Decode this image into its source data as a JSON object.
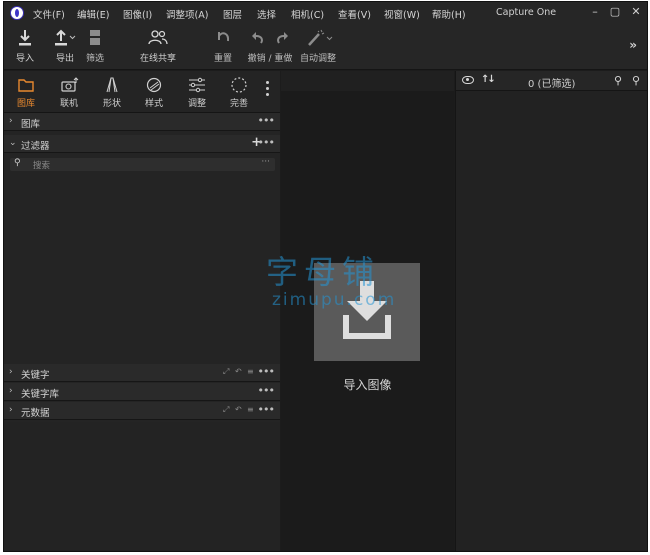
{
  "menu": {
    "items": [
      "文件(F)",
      "编辑(E)",
      "图像(I)",
      "调整项(A)",
      "图层",
      "选择",
      "相机(C)",
      "查看(V)",
      "视窗(W)",
      "帮助(H)"
    ],
    "app_title": "Capture One",
    "minimize": "–",
    "maximize": "▢",
    "close": "✕"
  },
  "toolbar": {
    "import": "导入",
    "export": "导出",
    "filter": "筛选",
    "share": "在线共享",
    "reset": "重置",
    "undo_redo": "撤销 / 重做",
    "auto_adjust": "自动调整",
    "more": "»"
  },
  "tabs": {
    "library": "图库",
    "tether": "联机",
    "shape": "形状",
    "style": "样式",
    "adjust": "调整",
    "refine": "完善"
  },
  "sections": {
    "library": "图库",
    "filters": "过滤器",
    "keywords": "关键字",
    "keyword_library": "关键字库",
    "metadata": "元数据"
  },
  "search": {
    "placeholder": "搜索"
  },
  "center": {
    "import_label": "导入图像"
  },
  "browser": {
    "count": "0 (已筛选)"
  },
  "watermark": {
    "line1": "字母铺",
    "line2": "zimupu.com"
  },
  "colors": {
    "accent": "#e8892f",
    "watermark": "#2496d6",
    "import_box": "#5a5a5a"
  }
}
